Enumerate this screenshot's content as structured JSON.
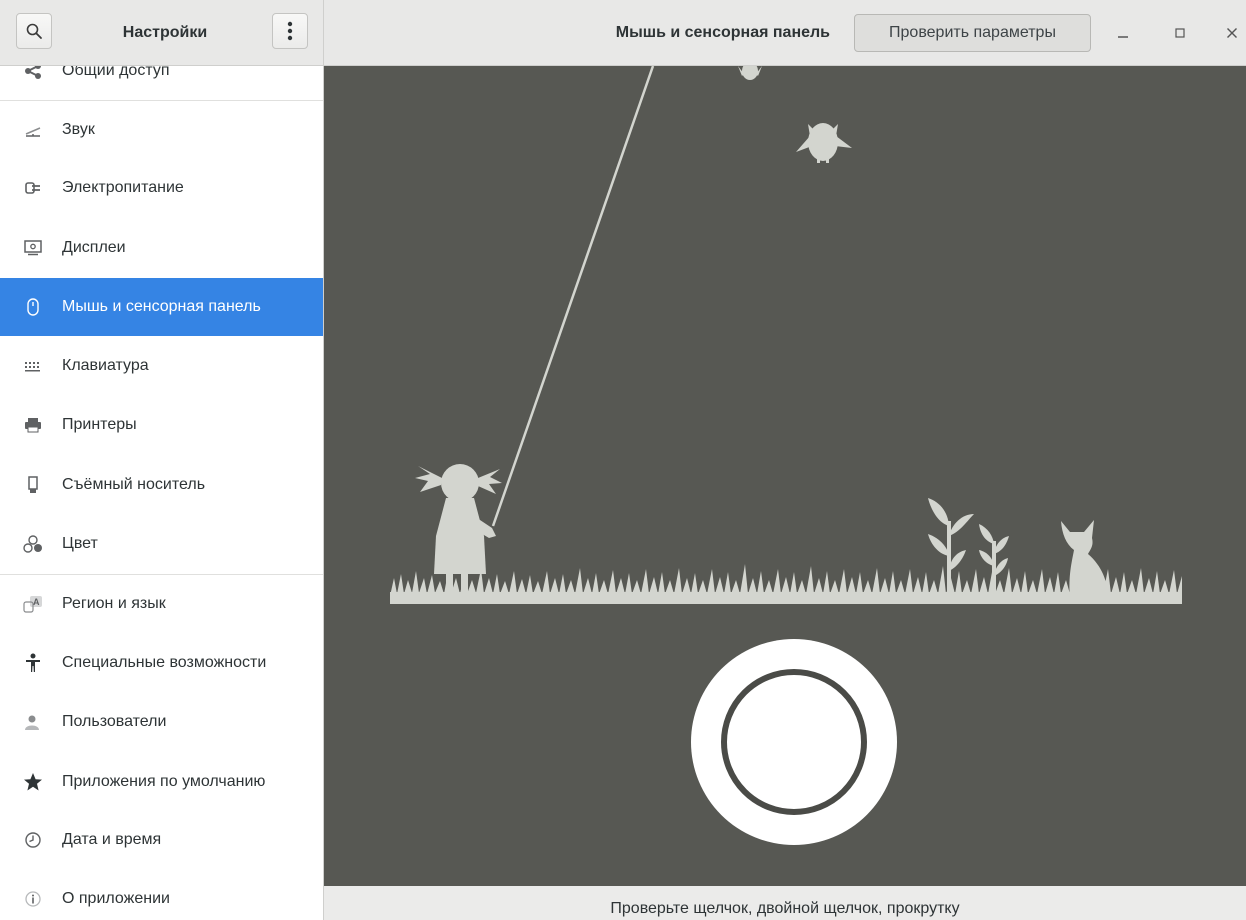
{
  "sidebar_header": {
    "title": "Настройки",
    "search_icon": "search-icon",
    "menu_icon": "vertical-dots-icon"
  },
  "header": {
    "title": "Мышь и сенсорная панель",
    "test_button_label": "Проверить параметры",
    "controls": [
      "minimize-icon",
      "maximize-icon",
      "close-icon"
    ]
  },
  "sidebar": {
    "items": [
      {
        "label": "Общий доступ",
        "icon": "share-icon"
      },
      {
        "label": "Звук",
        "icon": "sound-icon"
      },
      {
        "label": "Электропитание",
        "icon": "power-icon"
      },
      {
        "label": "Дисплеи",
        "icon": "display-icon"
      },
      {
        "label": "Мышь и сенсорная панель",
        "icon": "mouse-icon",
        "active": true
      },
      {
        "label": "Клавиатура",
        "icon": "keyboard-icon"
      },
      {
        "label": "Принтеры",
        "icon": "printer-icon"
      },
      {
        "label": "Съёмный носитель",
        "icon": "removable-media-icon"
      },
      {
        "label": "Цвет",
        "icon": "color-icon"
      },
      {
        "label": "Регион и язык",
        "icon": "region-language-icon"
      },
      {
        "label": "Специальные возможности",
        "icon": "accessibility-icon"
      },
      {
        "label": "Пользователи",
        "icon": "users-icon"
      },
      {
        "label": "Приложения по умолчанию",
        "icon": "star-icon"
      },
      {
        "label": "Дата и время",
        "icon": "clock-icon"
      },
      {
        "label": "О приложении",
        "icon": "info-icon"
      }
    ]
  },
  "main": {
    "footer_text": "Проверьте щелчок, двойной щелчок, прокрутку",
    "colors": {
      "background": "#575853",
      "silhouette": "#d3d5cf",
      "accent": "#3584e4"
    }
  }
}
